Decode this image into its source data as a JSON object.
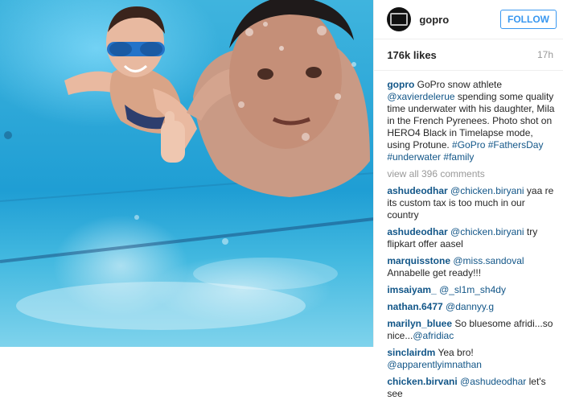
{
  "account": {
    "username": "gopro",
    "follow_label": "FOLLOW"
  },
  "stats": {
    "likes": "176k likes",
    "time": "17h"
  },
  "caption": {
    "user": "gopro",
    "text1": " GoPro snow athlete ",
    "mention": "@xavierdelerue",
    "text2": " spending some quality time underwater with his daughter, Mila in the French Pyrenees. Photo shot on HERO4 Black in Timelapse mode, using Protune. ",
    "tag1": "#GoPro",
    "tag2": "#FathersDay",
    "tag3": "#underwater",
    "tag4": "#family"
  },
  "view_all": "view all 396 comments",
  "comments": [
    {
      "user": "ashudeodhar",
      "mention": "@chicken.biryani",
      "text": " yaa re its custom tax is too much in our country"
    },
    {
      "user": "ashudeodhar",
      "mention": "@chicken.biryani",
      "text": " try flipkart offer aasel"
    },
    {
      "user": "marquisstone",
      "mention": "@miss.sandoval",
      "text": " Annabelle get ready!!!"
    },
    {
      "user": "imsaiyam_",
      "mention": "@_sl1m_sh4dy",
      "text": ""
    },
    {
      "user": "nathan.6477",
      "mention": "@dannyy.g",
      "text": ""
    },
    {
      "user": "marilyn_bluee",
      "text_before": " So bluesome afridi...so nice...",
      "mention": "@afridiac",
      "text": ""
    },
    {
      "user": "sinclairdm",
      "text_before": " Yea bro! ",
      "mention": "@apparentlyimnathan",
      "text": ""
    },
    {
      "user": "chicken.birvani",
      "mention": "@ashudeodhar",
      "text": " let's see"
    }
  ],
  "colors": {
    "link": "#125688",
    "follow": "#3897f0",
    "water": "#2ea8d8"
  }
}
